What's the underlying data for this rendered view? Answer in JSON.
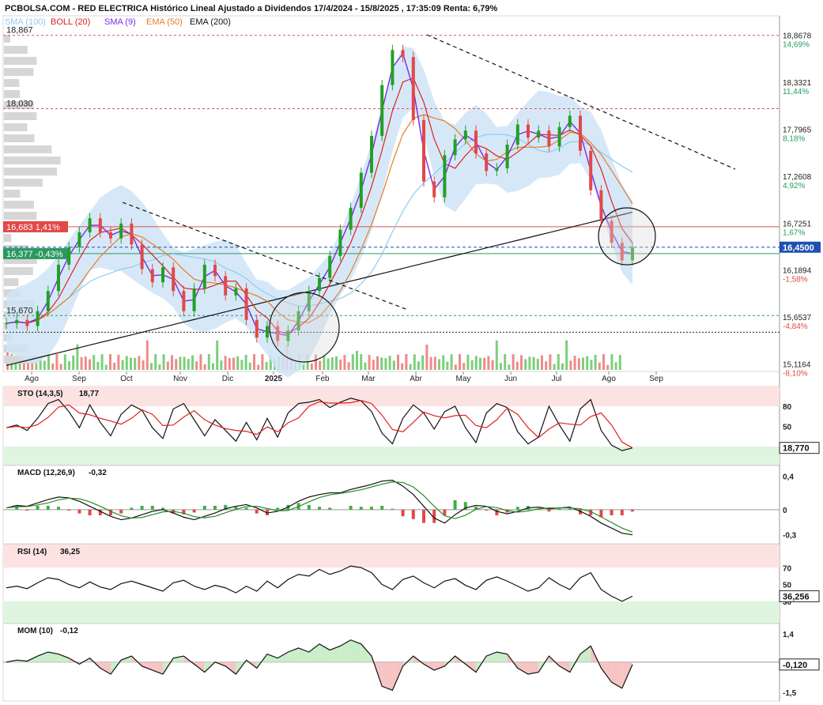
{
  "header": {
    "title": "PCBOLSA.COM - RED ELECTRICA Histórico Lineal Ajustado a Dividendos 17/4/2024 - 15/8/2025 , 17:35:09 Renta: 6,79%",
    "legend": [
      {
        "label": "SMA (100)",
        "color": "#8ecbf0"
      },
      {
        "label": "BOLL (20)",
        "color": "#e02020"
      },
      {
        "label": "SMA (9)",
        "color": "#7a2be2"
      },
      {
        "label": "EMA (50)",
        "color": "#e67e22"
      },
      {
        "label": "EMA (200)",
        "color": "#111111"
      }
    ]
  },
  "colors": {
    "up": "#22a022",
    "down": "#e24848",
    "boll_fill": "#cfe4f7",
    "resistance": "#e05050",
    "support": "#2a9a60",
    "current": "#1f4fb0"
  },
  "chart_data": [
    {
      "type": "candlestick",
      "panel": "price",
      "x_months": [
        "Ago",
        "Sep",
        "Oct",
        "Nov",
        "Dic",
        "2025",
        "Feb",
        "Mar",
        "Abr",
        "May",
        "Jun",
        "Jul",
        "Ago",
        "Sep"
      ],
      "y_axis_labels": [
        "18,8678",
        "18,3321",
        "17,7965",
        "17,2608",
        "16,7251",
        "16,1894",
        "15,6537",
        "15,1164"
      ],
      "y_axis_pcts": [
        "14,69%",
        "11,44%",
        "8,18%",
        "4,92%",
        "1,67%",
        "-1,58%",
        "-4,84%",
        "-8,10%"
      ],
      "ylim": [
        15.05,
        19.0
      ],
      "levels": [
        {
          "label": "18,867",
          "value": 18.867,
          "style": "resistance"
        },
        {
          "label": "18,030",
          "value": 18.03,
          "style": "resistance"
        },
        {
          "label": "16,683  1,41%",
          "value": 16.683,
          "style": "resistance-box"
        },
        {
          "label": "16,377  -0,43%",
          "value": 16.377,
          "style": "support-box"
        },
        {
          "label": "15,670",
          "value": 15.67,
          "style": "support"
        }
      ],
      "current_price_label": "16,4500",
      "current_price": 16.45,
      "price_path": [
        15.58,
        15.62,
        15.55,
        15.72,
        15.95,
        16.25,
        16.45,
        16.62,
        16.78,
        16.62,
        16.55,
        16.72,
        16.48,
        16.2,
        16.05,
        16.22,
        15.95,
        15.72,
        15.98,
        16.25,
        16.12,
        15.9,
        15.98,
        15.62,
        15.42,
        15.55,
        15.38,
        15.5,
        15.72,
        15.95,
        16.1,
        16.35,
        16.65,
        16.9,
        17.3,
        17.72,
        18.3,
        18.7,
        18.62,
        17.9,
        17.2,
        17.02,
        17.5,
        17.68,
        17.78,
        17.52,
        17.32,
        17.35,
        17.62,
        17.85,
        17.7,
        17.78,
        17.6,
        17.82,
        17.95,
        17.55,
        17.1,
        16.75,
        16.5,
        16.3,
        16.45
      ]
    },
    {
      "type": "line",
      "panel": "oscillator",
      "label": "STO (14,3,5)",
      "value_label": "18,77",
      "current_label": "18,770",
      "axis": [
        "80",
        "50",
        "20"
      ],
      "ylim": [
        0,
        100
      ],
      "values": [
        48,
        52,
        44,
        62,
        84,
        90,
        72,
        48,
        82,
        56,
        36,
        68,
        82,
        74,
        48,
        32,
        76,
        84,
        60,
        36,
        60,
        44,
        28,
        56,
        30,
        62,
        34,
        70,
        84,
        86,
        90,
        78,
        86,
        92,
        88,
        72,
        40,
        24,
        62,
        82,
        70,
        46,
        72,
        80,
        48,
        26,
        70,
        84,
        78,
        42,
        24,
        34,
        80,
        52,
        28,
        76,
        90,
        44,
        22,
        14,
        18
      ]
    },
    {
      "type": "line",
      "panel": "oscillator",
      "label": "MACD (12,26,9)",
      "value_label": "-0,32",
      "axis": [
        "0,4",
        "0",
        "-0,3"
      ],
      "ylim": [
        -0.35,
        0.45
      ],
      "values": [
        0.02,
        0.05,
        0.04,
        0.08,
        0.12,
        0.15,
        0.14,
        0.1,
        0.04,
        -0.02,
        -0.08,
        -0.12,
        -0.1,
        -0.06,
        -0.02,
        0.0,
        -0.04,
        -0.09,
        -0.12,
        -0.08,
        -0.04,
        0.01,
        0.04,
        0.06,
        0.02,
        -0.04,
        -0.02,
        0.03,
        0.1,
        0.15,
        0.18,
        0.2,
        0.2,
        0.24,
        0.27,
        0.3,
        0.34,
        0.35,
        0.28,
        0.18,
        0.04,
        -0.1,
        -0.16,
        -0.06,
        0.02,
        0.05,
        0.04,
        -0.02,
        -0.05,
        -0.02,
        0.02,
        0.03,
        0.01,
        0.02,
        0.03,
        -0.02,
        -0.08,
        -0.16,
        -0.22,
        -0.28,
        -0.3
      ]
    },
    {
      "type": "line",
      "panel": "oscillator",
      "label": "RSI (14)",
      "value_label": "36,25",
      "current_label": "36,256",
      "axis": [
        "70",
        "50",
        "30"
      ],
      "ylim": [
        10,
        90
      ],
      "values": [
        46,
        48,
        45,
        52,
        58,
        56,
        50,
        46,
        53,
        47,
        44,
        51,
        54,
        50,
        46,
        42,
        52,
        55,
        48,
        44,
        49,
        46,
        40,
        48,
        42,
        54,
        46,
        56,
        62,
        60,
        68,
        62,
        66,
        72,
        70,
        64,
        50,
        44,
        56,
        60,
        52,
        46,
        54,
        57,
        49,
        44,
        55,
        59,
        54,
        48,
        42,
        46,
        58,
        50,
        44,
        58,
        64,
        44,
        36,
        30,
        36
      ]
    },
    {
      "type": "line",
      "panel": "oscillator",
      "label": "MOM (10)",
      "value_label": "-0,12",
      "current_label": "-0,120",
      "axis": [
        "1,4",
        "0",
        "-1,5"
      ],
      "ylim": [
        -1.7,
        1.6
      ],
      "values": [
        0.0,
        0.1,
        0.05,
        0.3,
        0.5,
        0.4,
        0.2,
        -0.1,
        0.2,
        -0.3,
        -0.6,
        0.1,
        0.3,
        -0.2,
        -0.4,
        -0.6,
        0.2,
        0.3,
        -0.1,
        -0.5,
        0.0,
        -0.2,
        -0.6,
        0.1,
        -0.3,
        0.4,
        0.2,
        0.5,
        0.7,
        0.5,
        0.9,
        0.6,
        0.8,
        1.1,
        0.9,
        0.3,
        -1.2,
        -1.4,
        -0.2,
        0.3,
        -0.1,
        -0.4,
        -0.2,
        0.3,
        -0.1,
        -0.5,
        0.3,
        0.5,
        0.4,
        -0.3,
        -0.6,
        -0.5,
        0.3,
        -0.2,
        -0.5,
        0.4,
        0.8,
        -0.3,
        -1.0,
        -1.3,
        -0.12
      ]
    }
  ]
}
